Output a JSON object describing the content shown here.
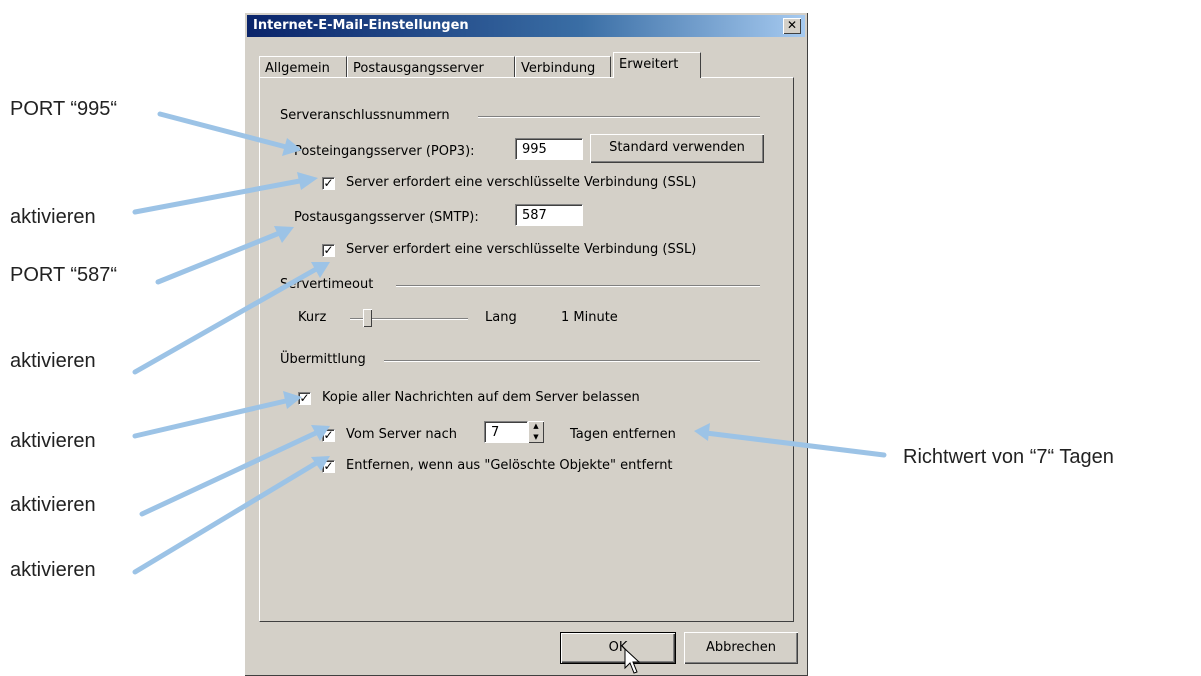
{
  "window": {
    "title": "Internet-E-Mail-Einstellungen",
    "close_glyph": "✕"
  },
  "tabs": [
    {
      "label": "Allgemein",
      "active": false
    },
    {
      "label": "Postausgangsserver",
      "active": false
    },
    {
      "label": "Verbindung",
      "active": false
    },
    {
      "label": "Erweitert",
      "active": true
    }
  ],
  "ports": {
    "group_label": "Serveranschlussnummern",
    "pop3_label": "Posteingangsserver (POP3):",
    "pop3_value": "995",
    "default_button": "Standard verwenden",
    "ssl_in_label": "Server erfordert eine verschlüsselte Verbindung (SSL)",
    "ssl_in_checked": true,
    "smtp_label": "Postausgangsserver (SMTP):",
    "smtp_value": "587",
    "ssl_out_label": "Server erfordert eine verschlüsselte Verbindung (SSL)",
    "ssl_out_checked": true
  },
  "timeout": {
    "group_label": "Servertimeout",
    "short_label": "Kurz",
    "long_label": "Lang",
    "value_label": "1 Minute",
    "level": 0.1
  },
  "delivery": {
    "group_label": "Übermittlung",
    "keep_copy_label": "Kopie aller Nachrichten auf dem Server belassen",
    "keep_copy_checked": true,
    "remove_after_prefix": "Vom Server nach",
    "remove_after_days": "7",
    "remove_after_suffix": "Tagen entfernen",
    "remove_after_checked": true,
    "remove_deleted_label": "Entfernen, wenn aus \"Gelöschte Objekte\" entfernt",
    "remove_deleted_checked": true
  },
  "buttons": {
    "ok": "OK",
    "cancel": "Abbrechen"
  },
  "annotations": {
    "port_995": "PORT “995“",
    "activate_1": "aktivieren",
    "port_587": "PORT “587“",
    "activate_2": "aktivieren",
    "activate_3": "aktivieren",
    "activate_4": "aktivieren",
    "activate_5": "aktivieren",
    "days_hint": "Richtwert von “7“ Tagen"
  },
  "colors": {
    "arrow": "#9cc3e6",
    "titlebar": "#0a246a",
    "dialog_bg": "#d4d0c8"
  }
}
